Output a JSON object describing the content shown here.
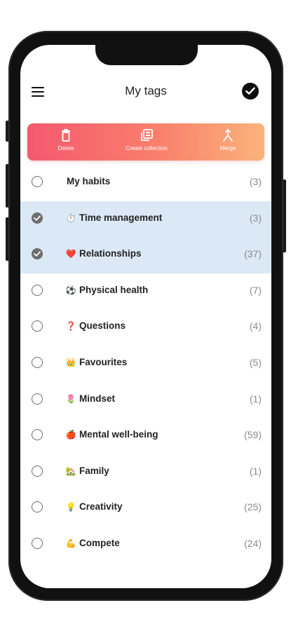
{
  "header": {
    "title": "My tags"
  },
  "actions": {
    "delete_label": "Delete",
    "create_collection_label": "Create collection",
    "merge_label": "Merge"
  },
  "tags": [
    {
      "emoji": "",
      "label": "My habits",
      "count": "(3)",
      "selected": false
    },
    {
      "emoji": "⏱️",
      "label": "Time management",
      "count": "(3)",
      "selected": true
    },
    {
      "emoji": "❤️",
      "label": "Relationships",
      "count": "(37)",
      "selected": true
    },
    {
      "emoji": "⚽",
      "label": "Physical health",
      "count": "(7)",
      "selected": false
    },
    {
      "emoji": "❓",
      "label": "Questions",
      "count": "(4)",
      "selected": false
    },
    {
      "emoji": "👑",
      "label": "Favourites",
      "count": "(5)",
      "selected": false
    },
    {
      "emoji": "🌷",
      "label": "Mindset",
      "count": "(1)",
      "selected": false
    },
    {
      "emoji": "🍎",
      "label": "Mental well-being",
      "count": "(59)",
      "selected": false
    },
    {
      "emoji": "🏡",
      "label": "Family",
      "count": "(1)",
      "selected": false
    },
    {
      "emoji": "💡",
      "label": "Creativity",
      "count": "(25)",
      "selected": false
    },
    {
      "emoji": "💪",
      "label": "Compete",
      "count": "(24)",
      "selected": false
    }
  ],
  "colors": {
    "gradient_start": "#f4596f",
    "gradient_end": "#fbb37a",
    "selected_row": "#dbe9f6"
  }
}
